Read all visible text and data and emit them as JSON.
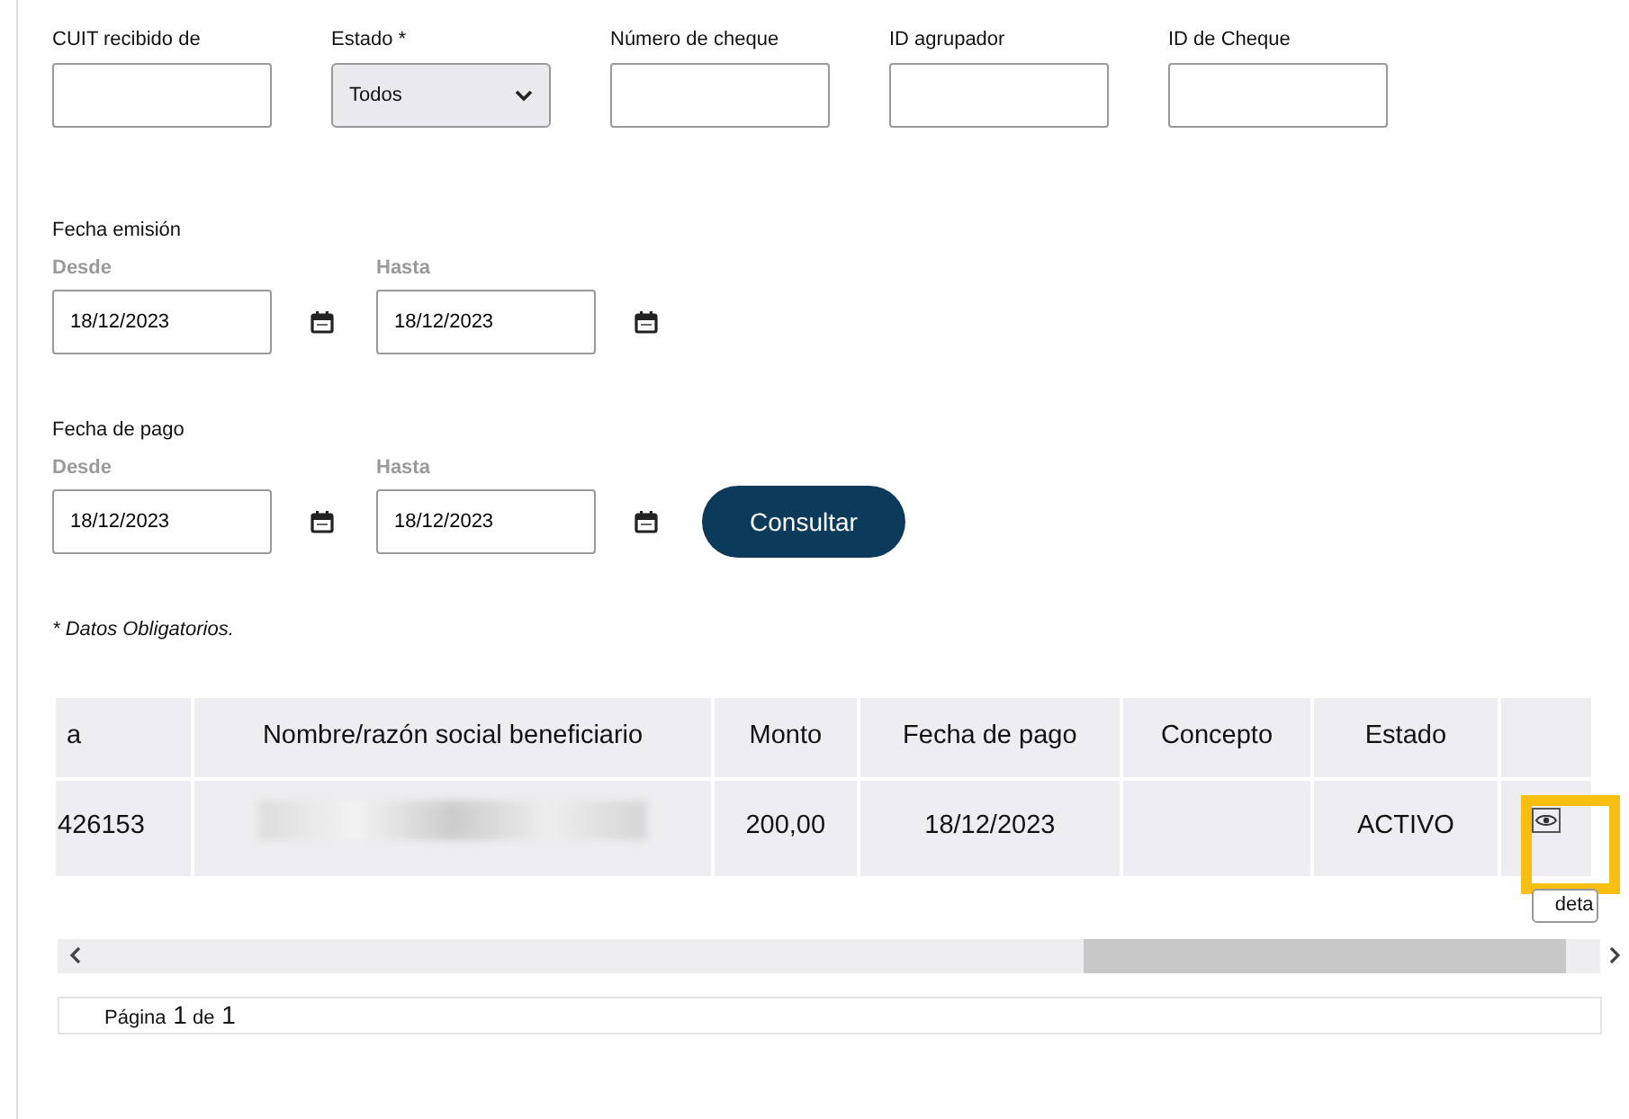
{
  "filters": [
    {
      "label": "CUIT recibido de",
      "kind": "text"
    },
    {
      "label": "Estado *",
      "kind": "select",
      "value": "Todos"
    },
    {
      "label": "Número de cheque",
      "kind": "text"
    },
    {
      "label": "ID agrupador",
      "kind": "text"
    },
    {
      "label": "ID de Cheque",
      "kind": "text"
    }
  ],
  "date_groups": [
    {
      "title": "Fecha emisión",
      "from_label": "Desde",
      "from": "18/12/2023",
      "to_label": "Hasta",
      "to": "18/12/2023"
    },
    {
      "title": "Fecha de pago",
      "from_label": "Desde",
      "from": "18/12/2023",
      "to_label": "Hasta",
      "to": "18/12/2023"
    }
  ],
  "submit": "Consultar",
  "note": "* Datos Obligatorios.",
  "table": {
    "columns": [
      "a",
      "Nombre/razón social beneficiario",
      "Monto",
      "Fecha de pago",
      "Concepto",
      "Estado"
    ],
    "rows": [
      {
        "cells": [
          "426153",
          null,
          "200,00",
          "18/12/2023",
          null,
          "ACTIVO"
        ],
        "highlighted": true,
        "tooltip": "deta"
      }
    ]
  },
  "pagination": {
    "label": "Página",
    "page": "1",
    "of": "de",
    "total": "1"
  }
}
